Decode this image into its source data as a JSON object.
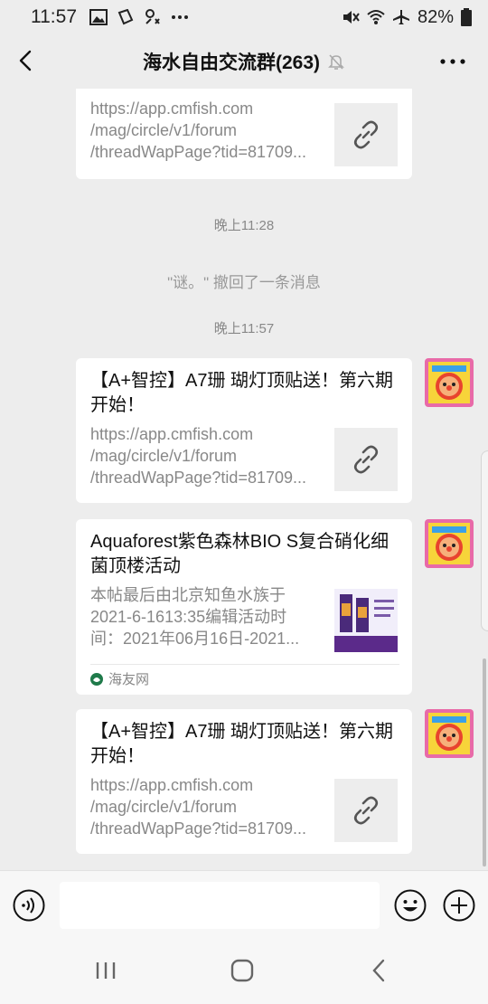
{
  "status_bar": {
    "time": "11:57",
    "left_icons": [
      "image-icon",
      "files-icon",
      "vpn-icon",
      "more-dots-icon"
    ],
    "right_icons": [
      "mute-icon",
      "wifi-icon",
      "airplane-icon",
      "battery-icon"
    ],
    "battery": "82%"
  },
  "header": {
    "title": "海水自由交流群(263)",
    "muted_icon": "bell-off-icon"
  },
  "chat": {
    "first_card": {
      "url_lines": [
        "https://app.cmfish.com",
        "/mag/circle/v1/forum",
        "/threadWapPage?tid=81709..."
      ]
    },
    "time_1": "晚上11:28",
    "recall_notice": "\"谜。\" 撤回了一条消息",
    "time_2": "晚上11:57",
    "msg_1": {
      "title": "【A+智控】A7珊 瑚灯顶贴送！第六期开始！",
      "url_lines": [
        "https://app.cmfish.com",
        "/mag/circle/v1/forum",
        "/threadWapPage?tid=81709..."
      ]
    },
    "msg_2": {
      "title": "Aquaforest紫色森林BIO S复合硝化细菌顶楼活动",
      "desc_lines": [
        "本帖最后由北京知鱼水族于",
        "2021-6-1613:35编辑活动时",
        "间：2021年06月16日-2021..."
      ],
      "source": "海友网"
    },
    "msg_3": {
      "title": "【A+智控】A7珊 瑚灯顶贴送！第六期开始！",
      "url_lines": [
        "https://app.cmfish.com",
        "/mag/circle/v1/forum",
        "/threadWapPage?tid=81709..."
      ]
    }
  },
  "input_bar": {
    "value": "",
    "placeholder": ""
  },
  "colors": {
    "background": "#ededed",
    "card": "#ffffff",
    "muted_text": "#888888"
  }
}
